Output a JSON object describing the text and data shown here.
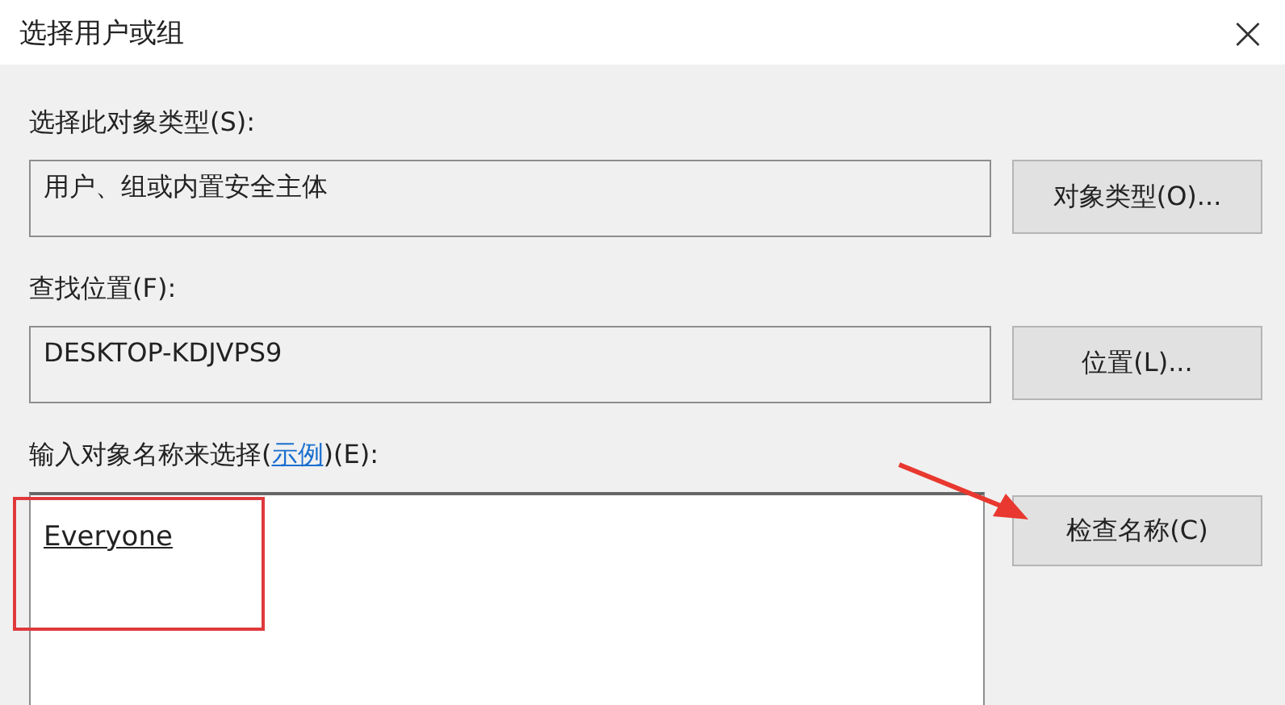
{
  "window": {
    "title": "选择用户或组",
    "close": "×"
  },
  "sections": [
    {
      "label": "选择此对象类型(S):",
      "value": "用户、组或内置安全主体",
      "button": "对象类型(O)..."
    },
    {
      "label": "查找位置(F):",
      "value": "DESKTOP-KDJVPS9",
      "button": "位置(L)..."
    }
  ],
  "names": {
    "label_before": "输入对象名称来选择(",
    "link": "示例",
    "label_after": ")(E):",
    "value": "Everyone",
    "button": "检查名称(C)"
  }
}
